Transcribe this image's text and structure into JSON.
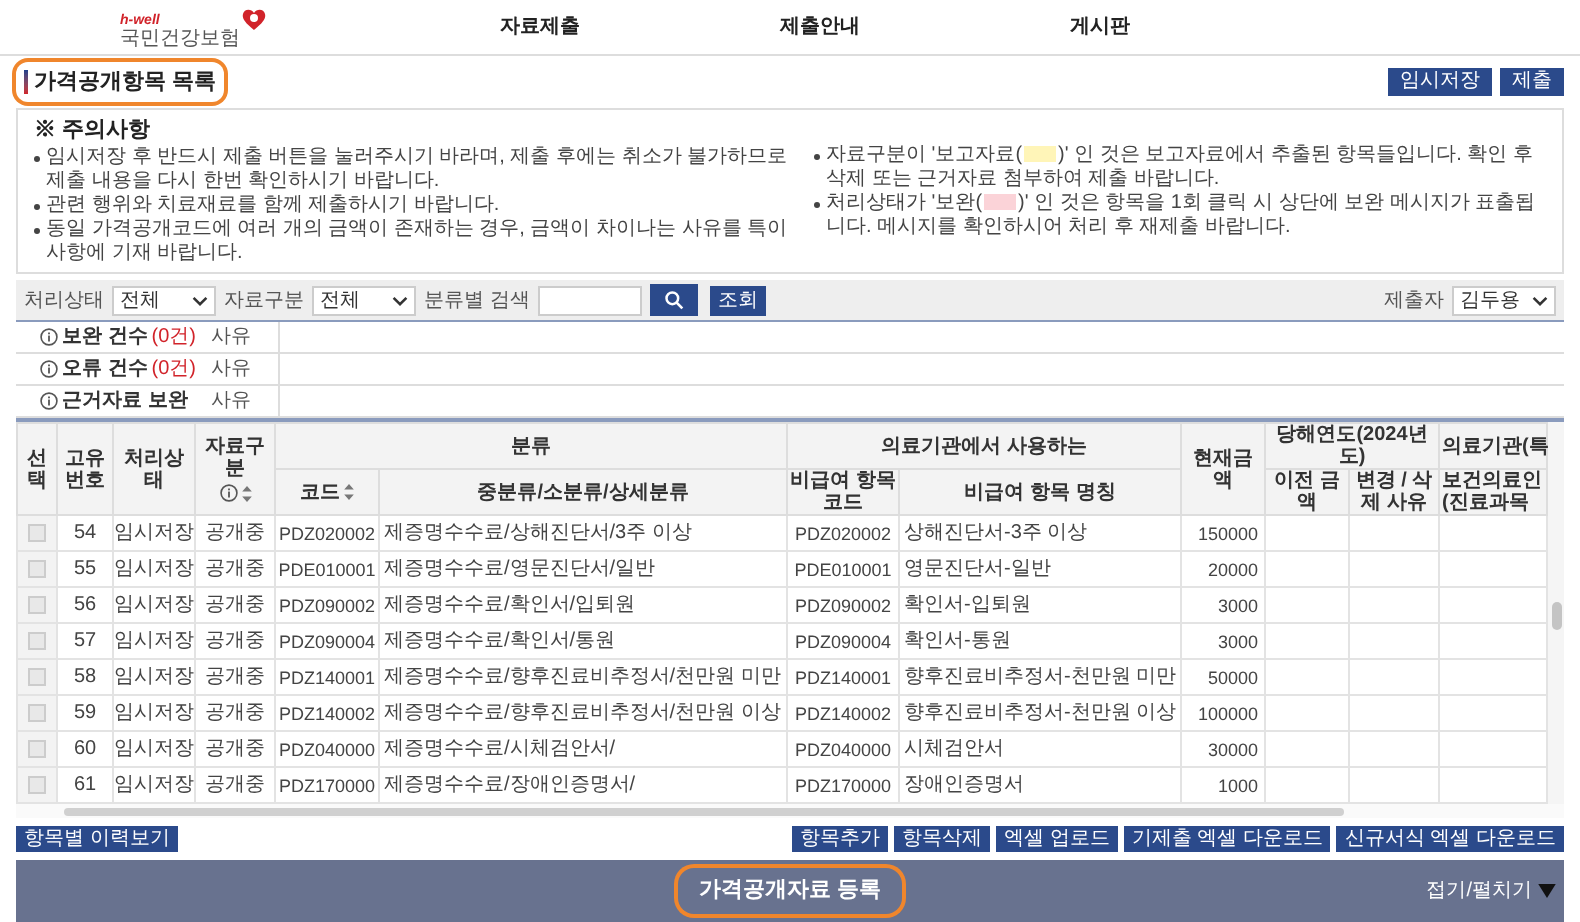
{
  "header": {
    "logo": {
      "tagline": "h-well",
      "name": "국민건강보험"
    },
    "nav": [
      {
        "label": "자료제출"
      },
      {
        "label": "제출안내"
      },
      {
        "label": "게시판"
      }
    ]
  },
  "page_title": {
    "text": "가격공개항목 목록",
    "highlighted": true
  },
  "actions": [
    "임시저장",
    "제출"
  ],
  "notice": {
    "title": "※ 주의사항",
    "left": [
      "임시저장 후 반드시 제출 버튼을 눌러주시기 바라며, 제출 후에는 취소가 불가하므로 제출 내용을 다시 한번 확인하시기 바랍니다.",
      "관련 행위와 치료재료를 함께 제출하시기 바랍니다.",
      "동일 가격공개코드에 여러 개의 금액이 존재하는 경우, 금액이 차이나는 사유를 특이사항에 기재 바랍니다."
    ],
    "right": [
      {
        "before": "자료구분이 '보고자료(",
        "color": "#fff5b8",
        "after": ")' 인 것은 보고자료에서 추출된 항목들입니다. 확인 후 삭제 또는 근거자료 첨부하여 제출 바랍니다."
      },
      {
        "before": "처리상태가 '보완(",
        "color": "#fbd3d8",
        "after": ")' 인 것은 항목을 1회 클릭 시 상단에 보완 메시지가 표출됩니다. 메시지를 확인하시어 처리 후 재제출 바랍니다."
      }
    ]
  },
  "filters": {
    "status": {
      "label": "처리상태",
      "value": "전체"
    },
    "type": {
      "label": "자료구분",
      "value": "전체"
    },
    "search": {
      "label": "분류별 검색"
    },
    "query_button": "조회",
    "submitter": {
      "label": "제출자",
      "value": "김두용"
    }
  },
  "info_rows": [
    {
      "label": "보완 건수",
      "count": "(0건)",
      "reason": "사유"
    },
    {
      "label": "오류 건수",
      "count": "(0건)",
      "reason": "사유"
    },
    {
      "label": "근거자료 보완",
      "reason": "사유"
    }
  ],
  "table": {
    "group_headers": [
      "분류",
      "의료기관에서 사용하는",
      "당해연도(2024년도)",
      "의료기관(특"
    ],
    "columns": [
      "선택",
      "고유번호",
      "처리상태",
      "자료구분",
      "코드",
      "중분류/소분류/상세분류",
      "비급여 항목 코드",
      "비급여 항목 명칭",
      "현재금액",
      "이전 금액",
      "변경 / 삭제 사유",
      "보건의료인(진료과목"
    ],
    "rows": [
      {
        "checked": false,
        "id": "54",
        "status": "임시저장",
        "type": "공개중",
        "code": "PDZ020002",
        "category": "제증명수수료/상해진단서/3주 이상",
        "item_code": "PDZ020002",
        "item_name": "상해진단서-3주 이상",
        "amount": "150000"
      },
      {
        "checked": false,
        "id": "55",
        "status": "임시저장",
        "type": "공개중",
        "code": "PDE010001",
        "category": "제증명수수료/영문진단서/일반",
        "item_code": "PDE010001",
        "item_name": "영문진단서-일반",
        "amount": "20000"
      },
      {
        "checked": false,
        "id": "56",
        "status": "임시저장",
        "type": "공개중",
        "code": "PDZ090002",
        "category": "제증명수수료/확인서/입퇴원",
        "item_code": "PDZ090002",
        "item_name": "확인서-입퇴원",
        "amount": "3000"
      },
      {
        "checked": false,
        "id": "57",
        "status": "임시저장",
        "type": "공개중",
        "code": "PDZ090004",
        "category": "제증명수수료/확인서/통원",
        "item_code": "PDZ090004",
        "item_name": "확인서-통원",
        "amount": "3000"
      },
      {
        "checked": false,
        "id": "58",
        "status": "임시저장",
        "type": "공개중",
        "code": "PDZ140001",
        "category": "제증명수수료/향후진료비추정서/천만원 미만",
        "item_code": "PDZ140001",
        "item_name": "향후진료비추정서-천만원 미만",
        "amount": "50000"
      },
      {
        "checked": false,
        "id": "59",
        "status": "임시저장",
        "type": "공개중",
        "code": "PDZ140002",
        "category": "제증명수수료/향후진료비추정서/천만원 이상",
        "item_code": "PDZ140002",
        "item_name": "향후진료비추정서-천만원 이상",
        "amount": "100000"
      },
      {
        "checked": false,
        "id": "60",
        "status": "임시저장",
        "type": "공개중",
        "code": "PDZ040000",
        "category": "제증명수수료/시체검안서/",
        "item_code": "PDZ040000",
        "item_name": "시체검안서",
        "amount": "30000"
      },
      {
        "checked": false,
        "id": "61",
        "status": "임시저장",
        "type": "공개중",
        "code": "PDZ170000",
        "category": "제증명수수료/장애인증명서/",
        "item_code": "PDZ170000",
        "item_name": "장애인증명서",
        "amount": "1000"
      }
    ]
  },
  "left_buttons": [
    "항목별 이력보기"
  ],
  "right_buttons": [
    "항목추가",
    "항목삭제",
    "엑셀 업로드",
    "기제출 엑셀 다운로드",
    "신규서식 엑셀 다운로드"
  ],
  "register_bar": {
    "title": "가격공개자료 등록",
    "highlighted": true,
    "toggle": "접기/펼치기"
  }
}
